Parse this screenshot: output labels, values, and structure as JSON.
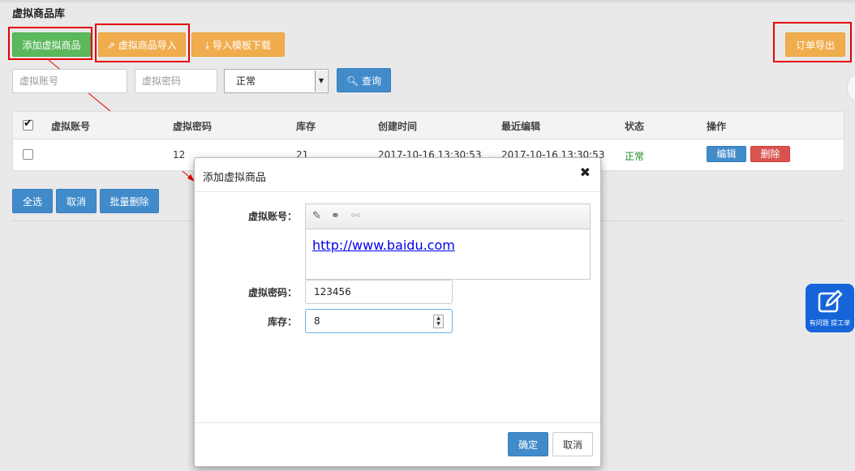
{
  "page": {
    "title": "虚拟商品库"
  },
  "toolbar": {
    "add_label": "添加虚拟商品",
    "import_label": "虚拟商品导入",
    "template_label": "导入模板下载",
    "export_label": "订单导出"
  },
  "filters": {
    "account_placeholder": "虚拟账号",
    "password_placeholder": "虚拟密码",
    "status_selected": "正常",
    "query_label": "查询"
  },
  "table": {
    "headers": [
      "虚拟账号",
      "虚拟密码",
      "库存",
      "创建时间",
      "最近编辑",
      "状态",
      "操作"
    ],
    "rows": [
      {
        "account": "",
        "password": "12",
        "stock": "21",
        "created": "2017-10-16 13:30:53",
        "edited": "2017-10-16 13:30:53",
        "status": "正常",
        "edit_label": "编辑",
        "delete_label": "删除"
      }
    ]
  },
  "bulk": {
    "select_all": "全选",
    "cancel": "取消",
    "batch_delete": "批量删除"
  },
  "help_widget": {
    "label": "有问题 提工单"
  },
  "modal": {
    "title": "添加虚拟商品",
    "account_label": "虚拟账号：",
    "account_value": "http://www.baidu.com",
    "password_label": "虚拟密码：",
    "password_value": "123456",
    "stock_label": "库存：",
    "stock_value": "8",
    "confirm_label": "确定",
    "cancel_label": "取消"
  },
  "colors": {
    "green": "#5cb85c",
    "orange": "#f0ad4e",
    "blue": "#428bca",
    "red": "#d9534f",
    "status_ok": "#228b22",
    "annotation": "#e60000"
  }
}
